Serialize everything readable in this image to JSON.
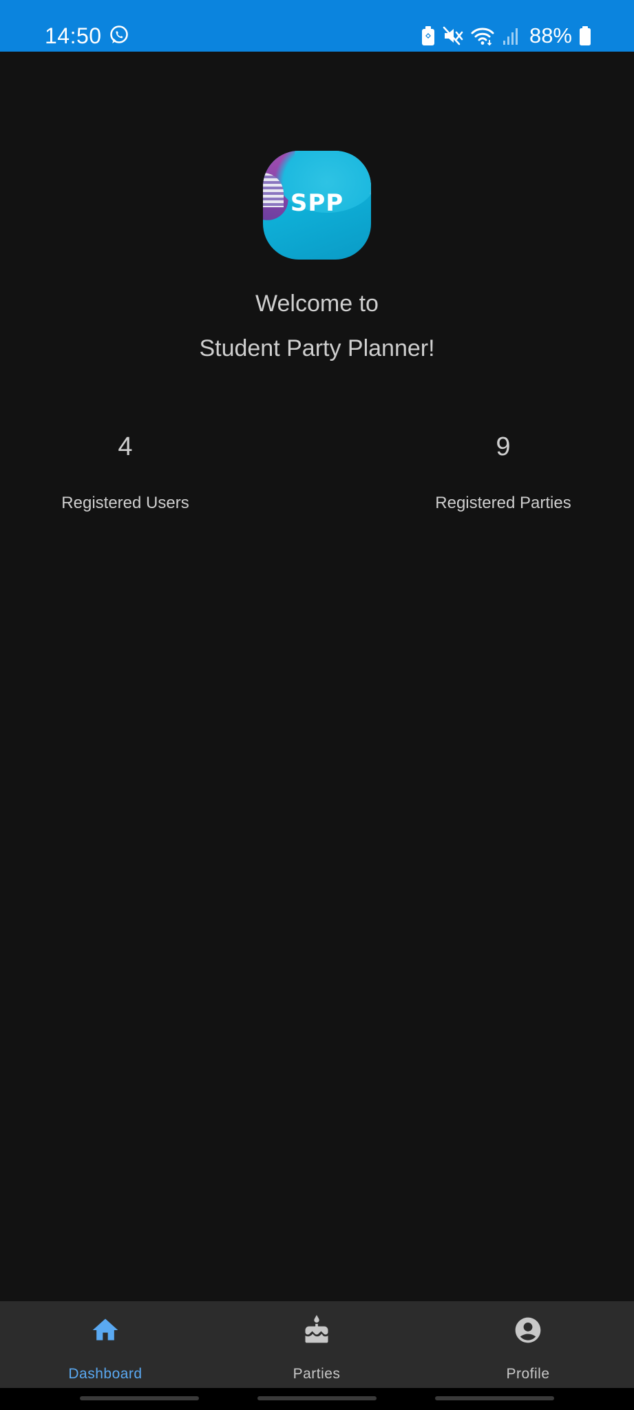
{
  "status_bar": {
    "time": "14:50",
    "battery": "88%",
    "icons": [
      "whatsapp-icon",
      "battery-saver-icon",
      "mute-icon",
      "wifi-icon",
      "signal-icon",
      "battery-icon"
    ],
    "background_color": "#0b84de"
  },
  "app": {
    "logo_text": "SPP",
    "welcome_line_1": "Welcome to",
    "welcome_line_2": "Student Party Planner!"
  },
  "stats": {
    "users": {
      "value": "4",
      "label": "Registered Users"
    },
    "parties": {
      "value": "9",
      "label": "Registered Parties"
    }
  },
  "bottom_nav": {
    "items": [
      {
        "label": "Dashboard",
        "icon": "home-icon",
        "active": true
      },
      {
        "label": "Parties",
        "icon": "cake-icon",
        "active": false
      },
      {
        "label": "Profile",
        "icon": "account-circle-icon",
        "active": false
      }
    ],
    "active_color": "#5aa9f2",
    "inactive_color": "#c8c8c8"
  }
}
